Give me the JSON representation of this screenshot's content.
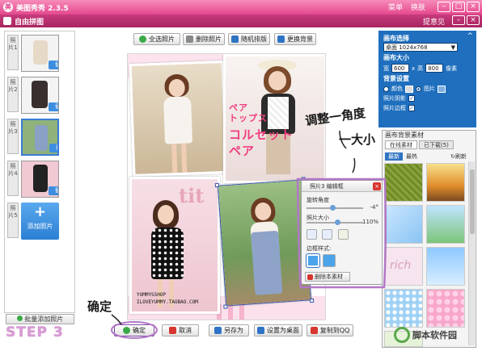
{
  "window": {
    "app_title": "美图秀秀 2.3.5",
    "menu": [
      "菜单",
      "换肤"
    ],
    "sub_title": "自由拼图",
    "feedback": "提意见"
  },
  "slots": [
    {
      "tab": "照片1",
      "replace": "替换"
    },
    {
      "tab": "照片2",
      "replace": "替换"
    },
    {
      "tab": "照片3",
      "replace": "替换"
    },
    {
      "tab": "照片4",
      "replace": "替换"
    },
    {
      "tab": "照片5",
      "add": "添加照片"
    }
  ],
  "batch_add_label": "批量添加照片",
  "toolbar": {
    "select_all": "全选照片",
    "delete_photo": "删除照片",
    "random_layout": "随机排版",
    "change_bg": "更换背景"
  },
  "bottom_bar": {
    "ok": "确定",
    "cancel": "取消",
    "save_as": "另存为",
    "set_wallpaper": "设置为桌面",
    "copy_qq": "复制到QQ"
  },
  "canvas": {
    "jp_line1": "ペア",
    "jp_line2": "トップス",
    "jp_line3": "コルセット",
    "jp_line4": "ペア",
    "photo_caption_1": "YUMMYSSHOP",
    "photo_caption_2": "ILOVEYUMMY.TAOBAO.COM",
    "bg_letters": "tit"
  },
  "edit_box": {
    "title": "照片3 编辑框",
    "rotate_label": "旋转角度",
    "rotate_value": "-4°",
    "size_label": "照片大小",
    "size_value": "110%",
    "border_label": "边框样式:",
    "delete_material": "删除本素材",
    "rotate_level": 0.46,
    "size_level": 0.55
  },
  "canvas_settings": {
    "title": "画布选择",
    "preset": "桌面 1024x768",
    "size_title": "画布大小",
    "width_label": "宽",
    "width": "600",
    "x_sep": "x",
    "height_label": "高",
    "height": "800",
    "unit": "像素",
    "bg_title": "背景设置",
    "color_option": "颜色",
    "image_option": "图片",
    "shadow_label": "照片阴影",
    "border_label": "照片边框",
    "collapse": "^"
  },
  "material_panel": {
    "title": "画布背景素材",
    "tabs": [
      "在线素材",
      "已下载(5)"
    ],
    "filters": [
      "最新",
      "最热"
    ],
    "refresh": "刷新",
    "tile_text": "rich"
  },
  "annotations": {
    "rotate": "调整一角度",
    "size": "一大小",
    "ok": "确定",
    "step": "STEP 3"
  },
  "watermark": "脚本软件园",
  "colors": {
    "title_pink": "#e5488e",
    "sub_magenta": "#a82460",
    "panel_blue": "#1f6fbe",
    "selection_blue": "#3354a8",
    "annotation_purple": "#b277c6"
  }
}
